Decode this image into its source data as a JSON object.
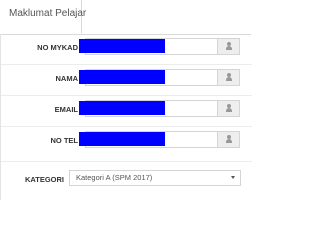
{
  "tabs": [
    {
      "label": "Maklumat Pelajar",
      "active": true
    }
  ],
  "form": {
    "fields": [
      {
        "label": "NO MYKAD",
        "icon": "user-icon",
        "value_redacted": true
      },
      {
        "label": "NAMA",
        "icon": "user-icon",
        "value_redacted": true
      },
      {
        "label": "EMAIL",
        "icon": "user-icon",
        "value_redacted": true
      },
      {
        "label": "NO TEL",
        "icon": "user-icon",
        "value_redacted": true
      }
    ],
    "kategori": {
      "label": "KATEGORI",
      "selected": "Kategori A (SPM 2017)",
      "icon": "chevron-down-icon"
    }
  },
  "colors": {
    "redaction": "#0000ff",
    "addon_bg": "#eeeeee",
    "border": "#d5d5d5"
  }
}
